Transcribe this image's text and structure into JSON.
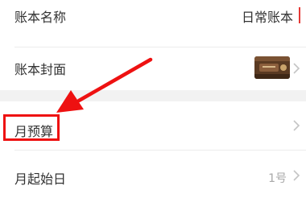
{
  "settings": {
    "name_row": {
      "label": "账本名称",
      "value": "日常账本"
    },
    "cover_row": {
      "label": "账本封面"
    },
    "budget_row": {
      "label": "月预算"
    },
    "start_day_row": {
      "label": "月起始日",
      "value": "1号"
    }
  },
  "annotation": {
    "color": "#ee1111"
  },
  "icons": {
    "chevron": "chevron-right-icon",
    "cover": "book-cover-thumbnail"
  }
}
